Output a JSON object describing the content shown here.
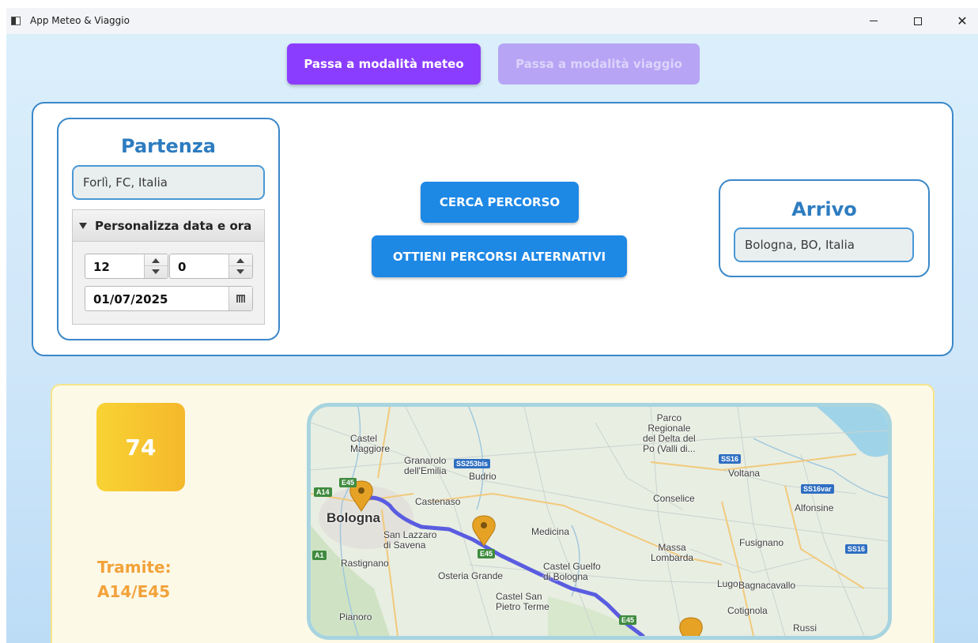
{
  "window": {
    "title": "App Meteo & Viaggio"
  },
  "mode_buttons": {
    "meteo": "Passa a modalità meteo",
    "viaggio": "Passa a modalità viaggio"
  },
  "partenza": {
    "title": "Partenza",
    "location": "Forlì, FC, Italia",
    "customize_label": "Personalizza data e ora",
    "hour": "12",
    "minute": "0",
    "date": "01/07/2025"
  },
  "actions": {
    "cerca": "CERCA PERCORSO",
    "alternativi": "OTTIENI PERCORSI ALTERNATIVI"
  },
  "arrivo": {
    "title": "Arrivo",
    "location": "Bologna, BO, Italia"
  },
  "result": {
    "duration": "74",
    "tramite_label": "Tramite:",
    "tramite_value": "A14/E45"
  },
  "map": {
    "places": {
      "castel_maggiore": "Castel\nMaggiore",
      "granarolo": "Granarolo\ndell'Emilia",
      "budrio": "Budrio",
      "castenaso": "Castenaso",
      "bologna": "Bologna",
      "san_lazzaro": "San Lazzaro\ndi Savena",
      "medicina": "Medicina",
      "rastignano": "Rastignano",
      "osteria_grande": "Osteria Grande",
      "castel_guelfo": "Castel Guelfo\ndi Bologna",
      "castel_san_pietro": "Castel San\nPietro Terme",
      "pianoro": "Pianoro",
      "parco": "Parco\nRegionale\ndel Delta del\nPo (Valli di...",
      "voltana": "Voltana",
      "conselice": "Conselice",
      "alfonsine": "Alfonsine",
      "massa_lombarda": "Massa\nLombarda",
      "fusignano": "Fusignano",
      "lugo": "Lugo",
      "bagnacavallo": "Bagnacavallo",
      "cotignola": "Cotignola",
      "russi": "Russi"
    },
    "road_shields": {
      "ss253bis": "SS253bis",
      "ss16_a": "SS16",
      "ss16var": "SS16var",
      "ss16_b": "SS16",
      "e45_a": "E45",
      "a14": "A14",
      "e45_b": "E45",
      "a1": "A1",
      "e45_c": "E45"
    }
  }
}
